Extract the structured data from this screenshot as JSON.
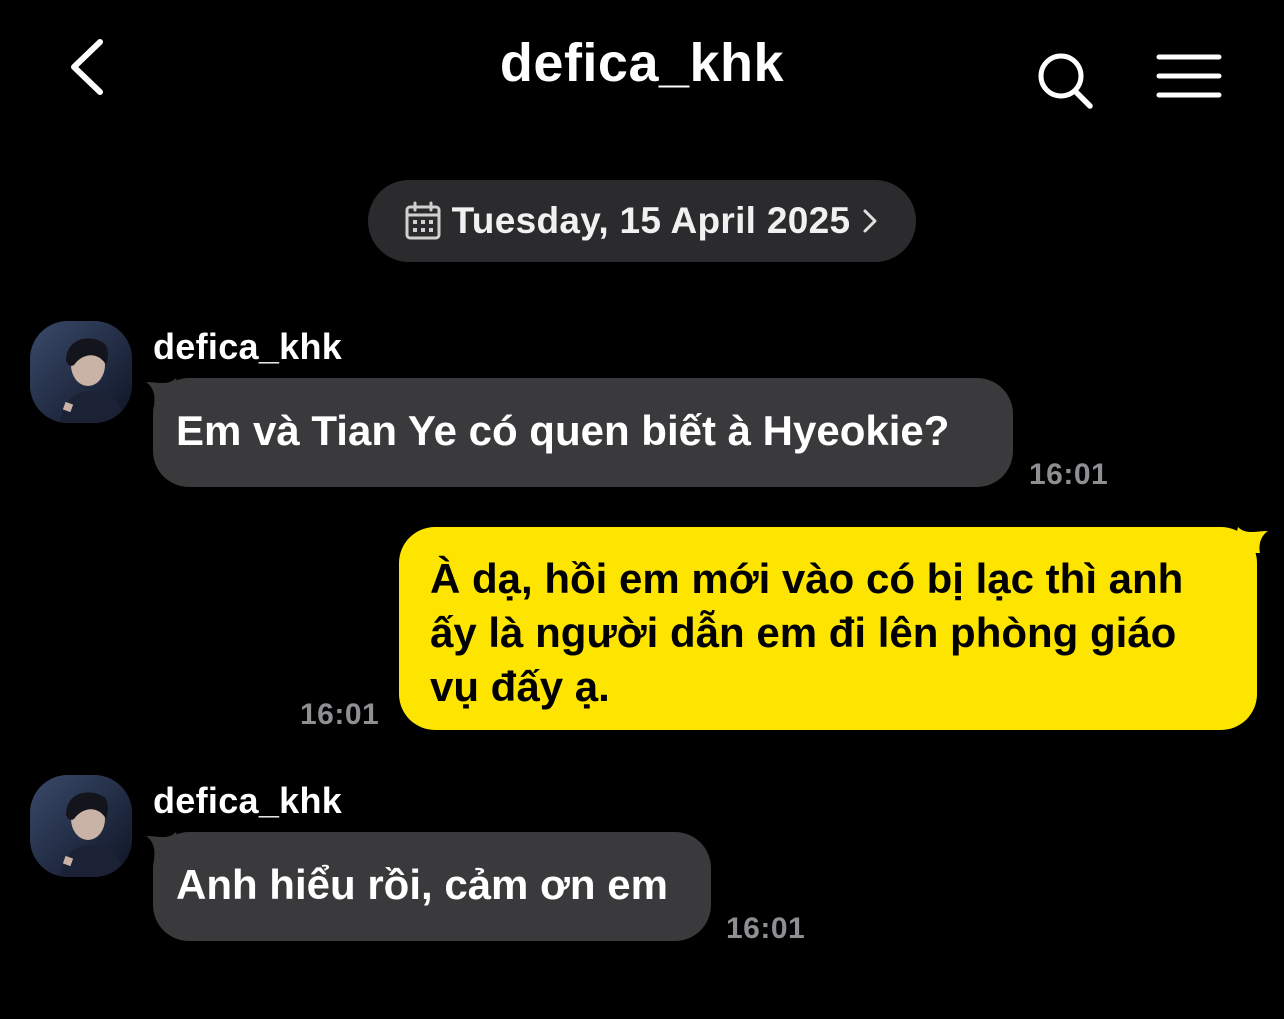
{
  "header": {
    "title": "defica_khk",
    "back_icon": "chevron-left-icon",
    "search_icon": "search-icon",
    "menu_icon": "hamburger-menu-icon"
  },
  "date_divider": {
    "label": "Tuesday, 15 April 2025",
    "icon": "calendar-icon",
    "chevron_icon": "chevron-right-icon"
  },
  "colors": {
    "background": "#000000",
    "incoming_bubble": "#3a3a3c",
    "outgoing_bubble": "#fee500",
    "timestamp": "#8e8e93",
    "date_pill": "#2b2b2d"
  },
  "messages": [
    {
      "direction": "incoming",
      "sender": "defica_khk",
      "text": "Em và Tian Ye có quen biết à Hyeokie?",
      "time": "16:01"
    },
    {
      "direction": "outgoing",
      "text": "À dạ, hồi em mới vào có bị lạc thì anh ấy là người dẫn em đi lên phòng giáo vụ đấy ạ.",
      "time": "16:01"
    },
    {
      "direction": "incoming",
      "sender": "defica_khk",
      "text": "Anh hiểu rồi, cảm ơn em",
      "time": "16:01"
    }
  ]
}
